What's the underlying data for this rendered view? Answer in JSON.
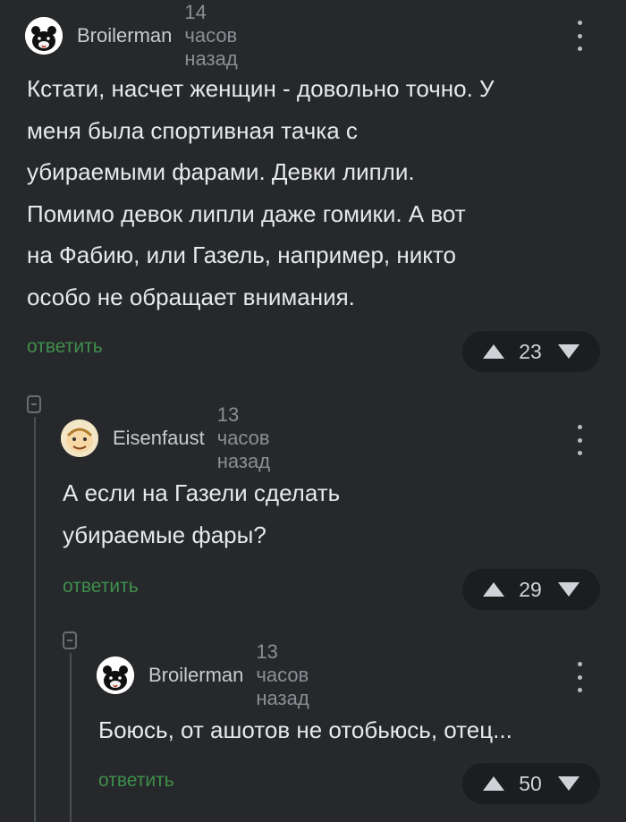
{
  "comments": [
    {
      "author": "Broilerman",
      "time": "14 часов назад",
      "avatar_icon": "bear-avatar-icon",
      "lines": [
        "Кстати, насчет женщин - довольно точно. У",
        "меня была спортивная тачка с",
        "убираемыми фарами. Девки липли.",
        "Помимо девок липли даже гомики. А вот",
        "на Фабию, или Газель, например, никто",
        "особо не обращает внимания."
      ],
      "reply_label": "ответить",
      "rating": "23"
    },
    {
      "author": "Eisenfaust",
      "time": "13 часов назад",
      "avatar_icon": "cartoon-face-avatar-icon",
      "lines": [
        "А если на Газели сделать",
        "убираемые фары?"
      ],
      "reply_label": "ответить",
      "rating": "29"
    },
    {
      "author": "Broilerman",
      "time": "13 часов назад",
      "avatar_icon": "bear-avatar-icon",
      "lines": [
        "Боюсь, от ашотов не отобьюсь, отец..."
      ],
      "reply_label": "ответить",
      "rating": "50"
    }
  ],
  "colors": {
    "background": "#26282b",
    "reply_link": "#3f8f4c",
    "vote_pill": "#1c1d1f"
  }
}
